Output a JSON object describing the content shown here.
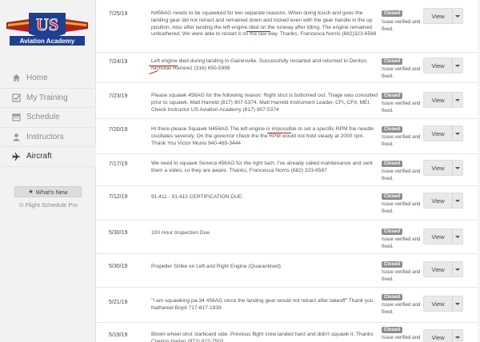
{
  "logo": {
    "text_big": "US",
    "text_small": "Aviation Academy"
  },
  "nav": {
    "items": [
      {
        "label": "Home",
        "icon": "home-icon"
      },
      {
        "label": "My Training",
        "icon": "checkbox-icon"
      },
      {
        "label": "Schedule",
        "icon": "calendar-icon"
      },
      {
        "label": "Instructors",
        "icon": "user-icon"
      },
      {
        "label": "Aircraft",
        "icon": "airplane-icon",
        "active": true
      }
    ]
  },
  "whats_new": {
    "icon": "star-icon",
    "label": "What's New"
  },
  "copyright": "© Flight Schedule Pro",
  "rows": [
    {
      "date": "7/25/19",
      "desc": "N456AG needs to be squawked for two separate reasons. When doing touch and goes the landing gear did not retract and remained down and locked even with the gear handle in the up position. Also after landing the left engine died on the runway after idling. The engine remained unfeathered. We were able to restart it on the taxi way. Thanks, Francesca Norris (682)323-6568",
      "status": "Closed",
      "status_note": "Issue verified and fixed.",
      "view": "View"
    },
    {
      "date": "7/24/19",
      "desc": "Left engine died during landing in Gainesville. Successfully restarted and returned to Denton. Nicholas Ramirez (316) 650-5999",
      "status": "Closed",
      "status_note": "Issue verified and fixed.",
      "view": "View"
    },
    {
      "date": "7/23/19",
      "desc": "Please squawk 456AG for the following reason: Right strut is bottomed out. Triage was consulted prior to squawk. Matt Harreld (817) 907-5374. Matt Harreld Instrument Leader, CFI, CFII, MEI, Check Instructor US Aviation Academy (817) 907-5374",
      "status": "Closed",
      "status_note": "Issue verified and fixed.",
      "view": "View"
    },
    {
      "date": "7/20/19",
      "desc": "Hi there please Squawk N456AG The left engine is impossible to set a specific RPM the needle oscillates severely. On the governor check the the RPM would not hold steady at 2000 rpm. Thank You Victor Munis 940-465-3444",
      "status": "Closed",
      "status_note": "Issue verified and fixed.",
      "view": "View"
    },
    {
      "date": "7/17/19",
      "desc": "We need to squawk Seneca 456AG for the right tach. I've already called maintenance and sent them a video, so they are aware. Thanks, Francesca Norris (682) 323-6567",
      "status": "Closed",
      "status_note": "Issue verified and fixed.",
      "view": "View"
    },
    {
      "date": "7/12/19",
      "desc": "91.411 - 91.413 CERTIFICATION DUE:",
      "status": "Closed",
      "status_note": "Issue verified and fixed.",
      "view": "View"
    },
    {
      "date": "5/30/19",
      "desc": "100 Hour Inspection Due",
      "status": "Closed",
      "status_note": "Issue verified and fixed.",
      "view": "View"
    },
    {
      "date": "5/30/19",
      "desc": "Propeller Strike on Left and Right Engine (Quarantined)",
      "status": "Closed",
      "status_note": "Issue verified and fixed.",
      "view": "View"
    },
    {
      "date": "5/21/19",
      "desc": "\"I am squawking pa-34 456AG since the landing gear would not retract after takeoff\" Thank you Nathaniel Boyd 717-817-1839",
      "status": "Closed",
      "status_note": "Issue verified and fixed.",
      "view": "View"
    },
    {
      "date": "5/19/19",
      "desc": "Blown wheel strut starboard side. Previous flight crew landed hard and didn't squawk it. Thanks Clayton Harlan (972) 822-7502",
      "status": "Closed",
      "status_note": "Issue verified and fixed.",
      "view": "View"
    }
  ]
}
